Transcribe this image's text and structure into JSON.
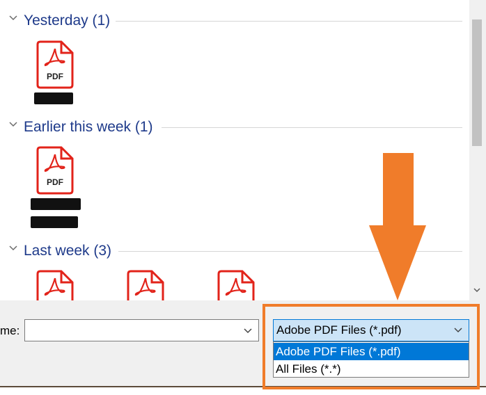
{
  "groups": [
    {
      "title": "Yesterday (1)"
    },
    {
      "title": "Earlier this week (1)"
    },
    {
      "title": "Last week (3)"
    }
  ],
  "file_icon_label": "PDF",
  "file_name_label": "me:",
  "file_name_value": "",
  "file_type": {
    "selected": "Adobe PDF Files (*.pdf)",
    "options": [
      "Adobe PDF Files (*.pdf)",
      "All Files (*.*)"
    ]
  },
  "colors": {
    "accent_arrow": "#f07c2a",
    "pdf_red": "#e2231a",
    "selection_blue": "#0078d7",
    "group_header_text": "#1e3a8a"
  },
  "icons": [
    "chevron-down-icon",
    "pdf-file-icon",
    "scroll-down-icon",
    "down-arrow-annotation"
  ]
}
